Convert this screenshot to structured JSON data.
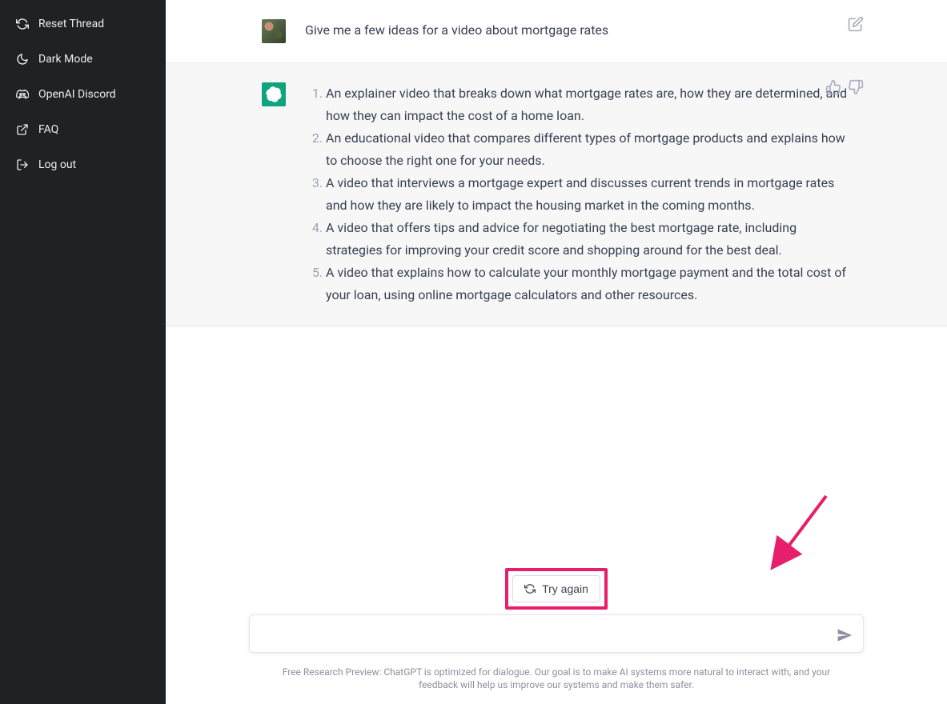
{
  "sidebar": {
    "items": [
      {
        "label": "Reset Thread"
      },
      {
        "label": "Dark Mode"
      },
      {
        "label": "OpenAI Discord"
      },
      {
        "label": "FAQ"
      },
      {
        "label": "Log out"
      }
    ]
  },
  "conversation": {
    "user_message": "Give me a few ideas for a video about mortgage rates",
    "bot_list": [
      "An explainer video that breaks down what mortgage rates are, how they are determined, and how they can impact the cost of a home loan.",
      "An educational video that compares different types of mortgage products and explains how to choose the right one for your needs.",
      "A video that interviews a mortgage expert and discusses current trends in mortgage rates and how they are likely to impact the housing market in the coming months.",
      "A video that offers tips and advice for negotiating the best mortgage rate, including strategies for improving your credit score and shopping around for the best deal.",
      "A video that explains how to calculate your monthly mortgage payment and the total cost of your loan, using online mortgage calculators and other resources."
    ]
  },
  "controls": {
    "try_again_label": "Try again",
    "input_placeholder": ""
  },
  "footer": {
    "disclaimer": "Free Research Preview: ChatGPT is optimized for dialogue. Our goal is to make AI systems more natural to interact with, and your feedback will help us improve our systems and make them safer."
  },
  "colors": {
    "sidebar_bg": "#202123",
    "bot_bg": "#f7f7f8",
    "accent": "#10a37f",
    "highlight": "#e61e6b"
  }
}
